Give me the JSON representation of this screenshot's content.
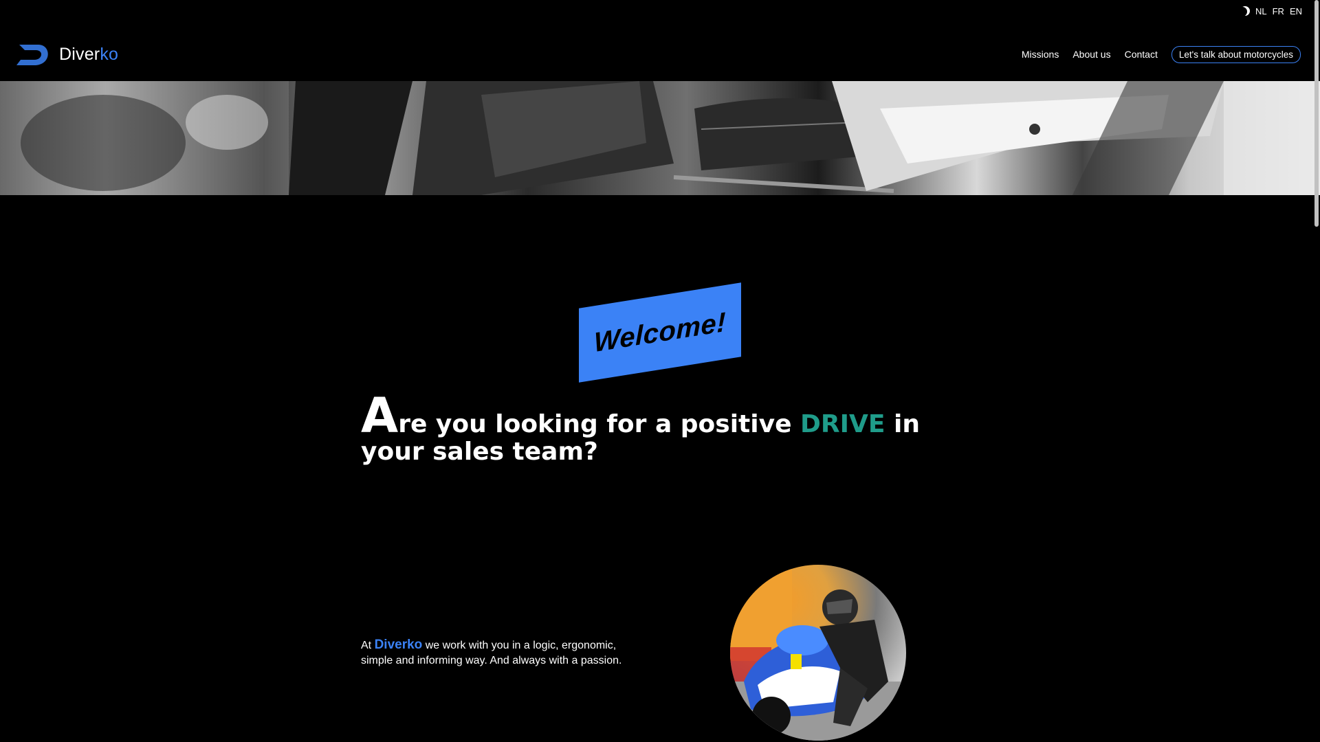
{
  "languages": [
    "NL",
    "FR",
    "EN"
  ],
  "brand": {
    "name_part1": "Diver",
    "name_part2": "ko",
    "accent_color": "#3b82f6"
  },
  "nav": {
    "items": [
      "Missions",
      "About us",
      "Contact"
    ],
    "cta": "Let's talk about motorcycles"
  },
  "welcome": {
    "label": "Welcome!",
    "color": "#3b82f6"
  },
  "headline": {
    "drop_cap": "A",
    "part1": "re you looking for a positive ",
    "highlight": "DRIVE",
    "part2": " in your sales team?",
    "highlight_color": "#1f9c8a"
  },
  "intro": {
    "prefix": "At ",
    "brand": "Diverko",
    "text": " we work with you in a logic, ergonomic, simple and informing way. And always with a passion."
  },
  "icons": {
    "theme_toggle": "moon-icon",
    "logo": "logo-d-icon"
  }
}
